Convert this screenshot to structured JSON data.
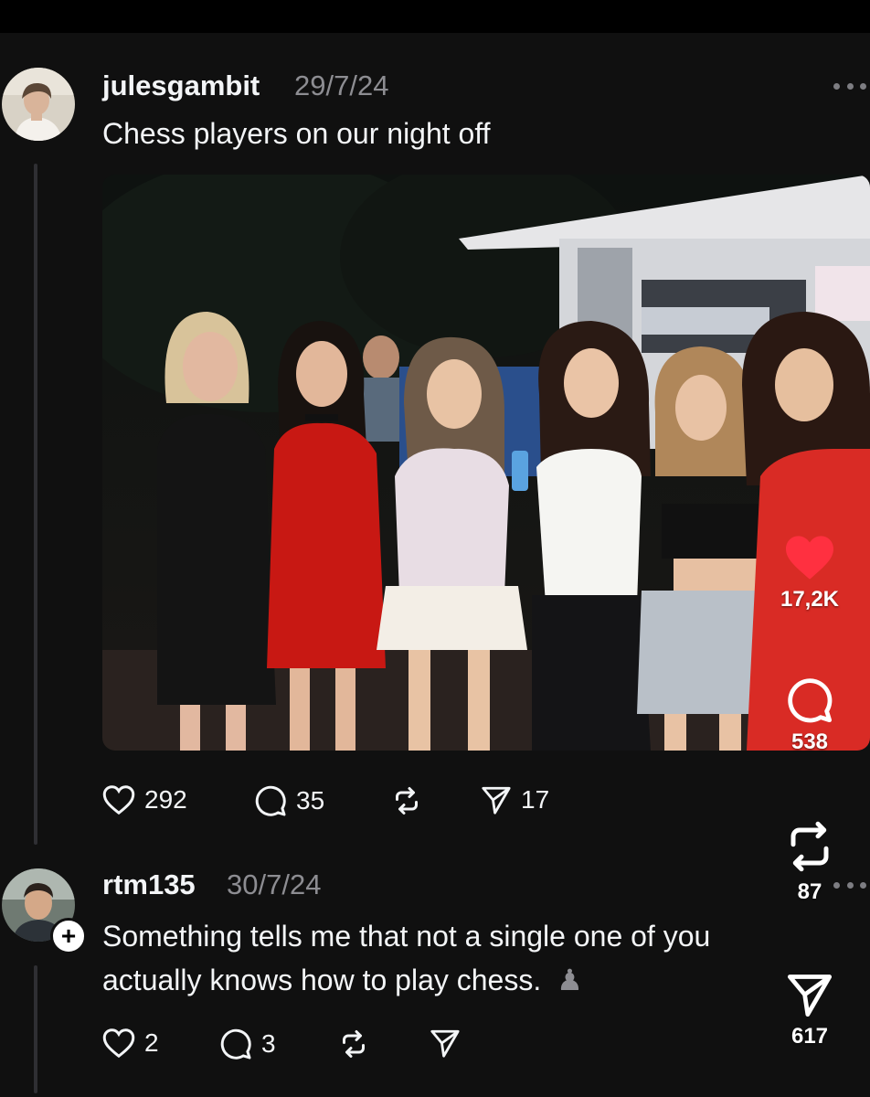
{
  "post": {
    "username": "julesgambit",
    "date": "29/7/24",
    "text": "Chess players on our night off",
    "likes": "292",
    "comments": "35",
    "shares": "17"
  },
  "reply": {
    "username": "rtm135",
    "date": "30/7/24",
    "line1": "Something tells me that not a single one of you",
    "line2": "actually knows how to play chess.",
    "chess_glyph": "♟",
    "likes": "2",
    "comments": "3",
    "plus_badge": "+"
  },
  "overlay": {
    "likes": "17,2K",
    "comments": "538",
    "reposts": "87",
    "shares": "617"
  },
  "colors": {
    "background": "#101010",
    "heart": "#ff3040",
    "muted_text": "#8d8d92",
    "thread_line": "#2f2f33"
  },
  "icons": [
    "heart-icon",
    "comment-icon",
    "repost-icon",
    "share-icon",
    "more-icon",
    "plus-icon"
  ]
}
